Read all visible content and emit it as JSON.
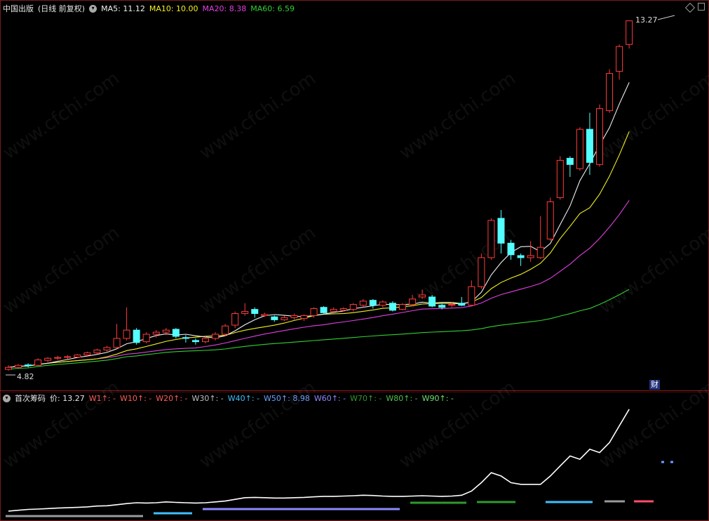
{
  "main_panel": {
    "stock_name": "中国出版",
    "period_label": "(日线 前复权)",
    "ma5_label": "MA5:",
    "ma5_value": "11.12",
    "ma10_label": "MA10:",
    "ma10_value": "10.00",
    "ma20_label": "MA20:",
    "ma20_value": "8.38",
    "ma60_label": "MA60:",
    "ma60_value": "6.59",
    "high_price_label": "13.27",
    "low_price_label": "4.82",
    "badge_text": "财"
  },
  "sub_panel": {
    "indicator_name": "首次筹码",
    "price_label": "价:",
    "price_value": "13.27",
    "w1": "W1↑: -",
    "w10": "W10↑: -",
    "w20": "W20↑: -",
    "w30": "W30↑: -",
    "w40": "W40↑: -",
    "w50": "W50↑: 8.98",
    "w60": "W60↑: -",
    "w70": "W70↑: -",
    "w80": "W80↑: -",
    "w90": "W90↑: -"
  },
  "watermark": "www.cfchi.com",
  "colors": {
    "up": "#ff3b3b",
    "down": "#54ffff",
    "ma5": "#f0f0f0",
    "ma10": "#f2f020",
    "ma20": "#e040e0",
    "ma60": "#30d030"
  },
  "chart_data": {
    "type": "candlestick",
    "candles": [
      [
        4.85,
        4.9,
        4.82,
        4.95
      ],
      [
        4.9,
        4.95,
        4.86,
        4.98
      ],
      [
        4.96,
        4.95,
        4.9,
        5.0
      ],
      [
        4.95,
        5.08,
        4.93,
        5.12
      ],
      [
        5.07,
        5.12,
        5.03,
        5.15
      ],
      [
        5.12,
        5.14,
        5.08,
        5.18
      ],
      [
        5.14,
        5.16,
        5.1,
        5.2
      ],
      [
        5.15,
        5.2,
        5.12,
        5.22
      ],
      [
        5.2,
        5.25,
        5.15,
        5.28
      ],
      [
        5.25,
        5.32,
        5.22,
        5.35
      ],
      [
        5.32,
        5.38,
        5.28,
        5.42
      ],
      [
        5.38,
        5.6,
        5.35,
        5.95
      ],
      [
        5.6,
        5.8,
        5.55,
        6.35
      ],
      [
        5.8,
        5.5,
        5.45,
        5.85
      ],
      [
        5.52,
        5.7,
        5.48,
        5.75
      ],
      [
        5.7,
        5.75,
        5.62,
        5.8
      ],
      [
        5.75,
        5.8,
        5.68,
        5.85
      ],
      [
        5.82,
        5.65,
        5.6,
        5.85
      ],
      [
        5.62,
        5.6,
        5.5,
        5.68
      ],
      [
        5.55,
        5.52,
        5.45,
        5.6
      ],
      [
        5.52,
        5.6,
        5.48,
        5.65
      ],
      [
        5.6,
        5.7,
        5.55,
        5.75
      ],
      [
        5.7,
        5.9,
        5.65,
        5.95
      ],
      [
        5.92,
        6.2,
        5.85,
        6.25
      ],
      [
        6.2,
        6.25,
        6.15,
        6.45
      ],
      [
        6.3,
        6.2,
        6.1,
        6.35
      ],
      [
        6.15,
        6.18,
        6.12,
        6.22
      ],
      [
        6.12,
        6.05,
        6.0,
        6.15
      ],
      [
        6.05,
        6.1,
        6.02,
        6.15
      ],
      [
        6.1,
        6.15,
        6.05,
        6.2
      ],
      [
        6.08,
        6.15,
        6.02,
        6.18
      ],
      [
        6.15,
        6.32,
        6.1,
        6.35
      ],
      [
        6.35,
        6.22,
        6.2,
        6.38
      ],
      [
        6.25,
        6.3,
        6.2,
        6.35
      ],
      [
        6.28,
        6.32,
        6.25,
        6.35
      ],
      [
        6.3,
        6.42,
        6.25,
        6.45
      ],
      [
        6.4,
        6.5,
        6.35,
        6.55
      ],
      [
        6.52,
        6.4,
        6.32,
        6.55
      ],
      [
        6.4,
        6.48,
        6.35,
        6.52
      ],
      [
        6.45,
        6.28,
        6.25,
        6.5
      ],
      [
        6.3,
        6.42,
        6.28,
        6.45
      ],
      [
        6.42,
        6.55,
        6.38,
        6.65
      ],
      [
        6.6,
        6.65,
        6.55,
        6.78
      ],
      [
        6.6,
        6.38,
        6.35,
        6.65
      ],
      [
        6.4,
        6.35,
        6.3,
        6.45
      ],
      [
        6.4,
        6.42,
        6.35,
        6.48
      ],
      [
        6.45,
        6.4,
        6.38,
        6.6
      ],
      [
        6.4,
        6.85,
        6.38,
        7.0
      ],
      [
        6.85,
        7.55,
        6.8,
        7.65
      ],
      [
        7.55,
        8.45,
        7.5,
        8.5
      ],
      [
        8.5,
        7.9,
        7.65,
        8.7
      ],
      [
        7.9,
        7.62,
        7.5,
        7.98
      ],
      [
        7.6,
        7.55,
        7.35,
        7.65
      ],
      [
        7.55,
        7.6,
        7.45,
        7.95
      ],
      [
        7.55,
        7.8,
        7.52,
        8.55
      ],
      [
        8.0,
        8.9,
        7.95,
        9.0
      ],
      [
        9.0,
        9.9,
        8.95,
        10.0
      ],
      [
        9.95,
        9.8,
        9.5,
        10.0
      ],
      [
        9.7,
        10.65,
        9.65,
        10.7
      ],
      [
        10.65,
        9.85,
        9.55,
        11.05
      ],
      [
        9.8,
        11.15,
        9.75,
        11.25
      ],
      [
        11.1,
        12.0,
        11.05,
        12.1
      ],
      [
        12.05,
        12.65,
        11.85,
        12.7
      ],
      [
        12.7,
        13.27,
        12.6,
        13.27
      ]
    ],
    "ma5_last": 11.12,
    "ma10_last": 10.0,
    "ma20_last": 8.38,
    "ma60_last": 6.59,
    "price_high_marker": 13.27,
    "price_low_marker": 4.82,
    "sub_cost_line": [
      4.9,
      4.95,
      5.0,
      5.02,
      5.05,
      5.08,
      5.1,
      5.12,
      5.15,
      5.2,
      5.22,
      5.28,
      5.35,
      5.4,
      5.38,
      5.4,
      5.45,
      5.42,
      5.4,
      5.38,
      5.4,
      5.45,
      5.5,
      5.6,
      5.7,
      5.72,
      5.7,
      5.68,
      5.68,
      5.7,
      5.72,
      5.75,
      5.78,
      5.78,
      5.8,
      5.82,
      5.85,
      5.83,
      5.8,
      5.78,
      5.78,
      5.8,
      5.82,
      5.8,
      5.78,
      5.8,
      5.85,
      6.1,
      6.6,
      7.2,
      7.0,
      6.6,
      6.5,
      6.5,
      6.5,
      7.0,
      7.6,
      8.2,
      8.0,
      8.6,
      8.4,
      9.0,
      10.0,
      11.0
    ]
  }
}
